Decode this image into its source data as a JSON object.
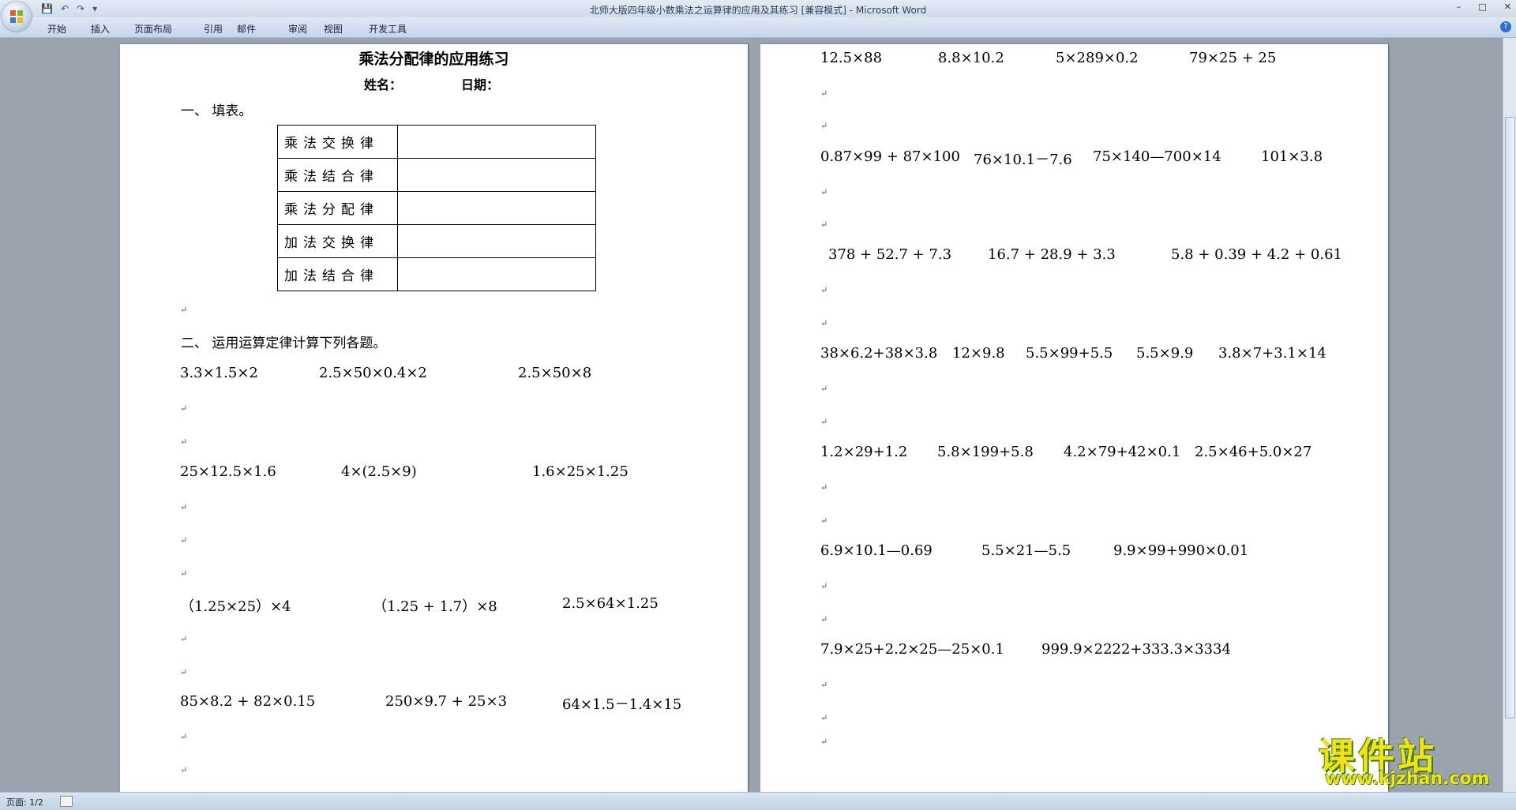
{
  "window": {
    "title": "北师大版四年级小数乘法之运算律的应用及其练习 [兼容模式] - Microsoft Word",
    "controls": [
      "–",
      "□",
      "✕"
    ]
  },
  "quick_access": {
    "save": "💾",
    "undo": "↶",
    "redo": "↷",
    "customize": "▾"
  },
  "ribbon_tabs": [
    "开始",
    "插入",
    "页面布局",
    "引用",
    "邮件",
    "审阅",
    "视图",
    "开发工具"
  ],
  "help": "?",
  "document": {
    "title": "乘法分配律的应用练习",
    "name_label": "姓名：",
    "date_label": "日期：",
    "section1": "一、   填表。",
    "laws": [
      "乘法交换律",
      "乘法结合律",
      "乘法分配律",
      "加法交换律",
      "加法结合律"
    ],
    "section2": "二、   运用运算定律计算下列各题。",
    "left_rows": [
      [
        "3.3×1.5×2",
        "2.5×50×0.4×2",
        "2.5×50×8"
      ],
      [
        "25×12.5×1.6",
        "4×(2.5×9)",
        "1.6×25×1.25"
      ],
      [
        "（1.25×25）×4",
        "（1.25 + 1.7）×8",
        "2.5×64×1.25"
      ],
      [
        "85×8.2 + 82×0.15",
        "250×9.7 + 25×3",
        "64×1.5－1.4×15"
      ]
    ],
    "right_rows": [
      [
        "12.5×88",
        "8.8×10.2",
        "5×289×0.2",
        "79×25 + 25"
      ],
      [
        "0.87×99 + 87×100",
        "76×10.1－7.6",
        "75×140—700×14",
        "101×3.8"
      ],
      [
        "378 + 52.7 + 7.3",
        "16.7 + 28.9 + 3.3",
        "5.8 + 0.39 + 4.2 + 0.61"
      ],
      [
        "38×6.2+38×3.8",
        "12×9.8",
        "5.5×99+5.5",
        "5.5×9.9",
        "3.8×7+3.1×14"
      ],
      [
        "1.2×29+1.2",
        "5.8×199+5.8",
        "4.2×79+42×0.1",
        "2.5×46+5.0×27"
      ],
      [
        "6.9×10.1—0.69",
        "5.5×21—5.5",
        "9.9×99+990×0.01"
      ],
      [
        "7.9×25+2.2×25—25×0.1",
        "999.9×2222+333.3×3334"
      ]
    ],
    "para_mark": "↵"
  },
  "status": {
    "page": "页面: 1/2"
  },
  "watermark": {
    "text": "课件站",
    "url": "www.kjzhan.com"
  }
}
